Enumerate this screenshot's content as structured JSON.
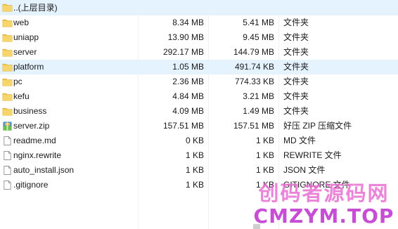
{
  "colors": {
    "folder": "#f2c94c",
    "selected_row_bg": "#e5f3ff",
    "watermark_top": "#e86fd2",
    "watermark_bottom": "#c23bd0"
  },
  "files": [
    {
      "name": "..(上层目录)",
      "size": "",
      "packed": "",
      "type": "",
      "icon": "folder-icon",
      "highlight": true
    },
    {
      "name": "web",
      "size": "8.34 MB",
      "packed": "5.41 MB",
      "type": "文件夹",
      "icon": "folder-icon"
    },
    {
      "name": "uniapp",
      "size": "13.90 MB",
      "packed": "9.45 MB",
      "type": "文件夹",
      "icon": "folder-icon"
    },
    {
      "name": "server",
      "size": "292.17 MB",
      "packed": "144.79 MB",
      "type": "文件夹",
      "icon": "folder-icon"
    },
    {
      "name": "platform",
      "size": "1.05 MB",
      "packed": "491.74 KB",
      "type": "文件夹",
      "icon": "folder-icon",
      "highlight": true
    },
    {
      "name": "pc",
      "size": "2.36 MB",
      "packed": "774.33 KB",
      "type": "文件夹",
      "icon": "folder-icon"
    },
    {
      "name": "kefu",
      "size": "4.84 MB",
      "packed": "3.21 MB",
      "type": "文件夹",
      "icon": "folder-icon"
    },
    {
      "name": "business",
      "size": "4.09 MB",
      "packed": "1.49 MB",
      "type": "文件夹",
      "icon": "folder-icon"
    },
    {
      "name": "server.zip",
      "size": "157.51 MB",
      "packed": "157.51 MB",
      "type": "好压 ZIP 压缩文件",
      "icon": "zip-archive-icon"
    },
    {
      "name": "readme.md",
      "size": "0 KB",
      "packed": "1 KB",
      "type": "MD 文件",
      "icon": "file-icon"
    },
    {
      "name": "nginx.rewrite",
      "size": "1 KB",
      "packed": "1 KB",
      "type": "REWRITE 文件",
      "icon": "file-icon"
    },
    {
      "name": "auto_install.json",
      "size": "1 KB",
      "packed": "1 KB",
      "type": "JSON 文件",
      "icon": "file-icon"
    },
    {
      "name": ".gitignore",
      "size": "1 KB",
      "packed": "1 KB",
      "type": "GITIGNORE 文件",
      "icon": "file-icon"
    }
  ],
  "watermark": {
    "line1": "创码者源码网",
    "line2": "CMZYM.TOP"
  }
}
